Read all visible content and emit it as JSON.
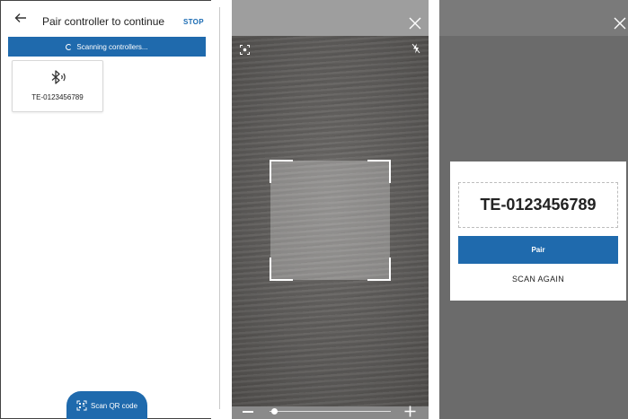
{
  "pair_screen": {
    "title": "Pair controller to continue",
    "stop_label": "STOP",
    "scanning_text": "Scanning controllers...",
    "device": {
      "name": "TE-0123456789",
      "icon": "bluetooth-searching-icon"
    },
    "scan_qr_label": "Scan QR code"
  },
  "camera_screen": {
    "close_icon": "close-icon",
    "focus_icon": "focus-icon",
    "flash_icon": "flash-off-icon",
    "zoom_level": 0.02
  },
  "confirm_screen": {
    "close_icon": "close-icon",
    "controller_code": "TE-0123456789",
    "pair_label": "Pair",
    "scan_again_label": "SCAN AGAIN"
  },
  "colors": {
    "accent": "#1f6aad",
    "camera_bg": "#5e5c5a",
    "overlay_bg": "#6b6b6b"
  }
}
